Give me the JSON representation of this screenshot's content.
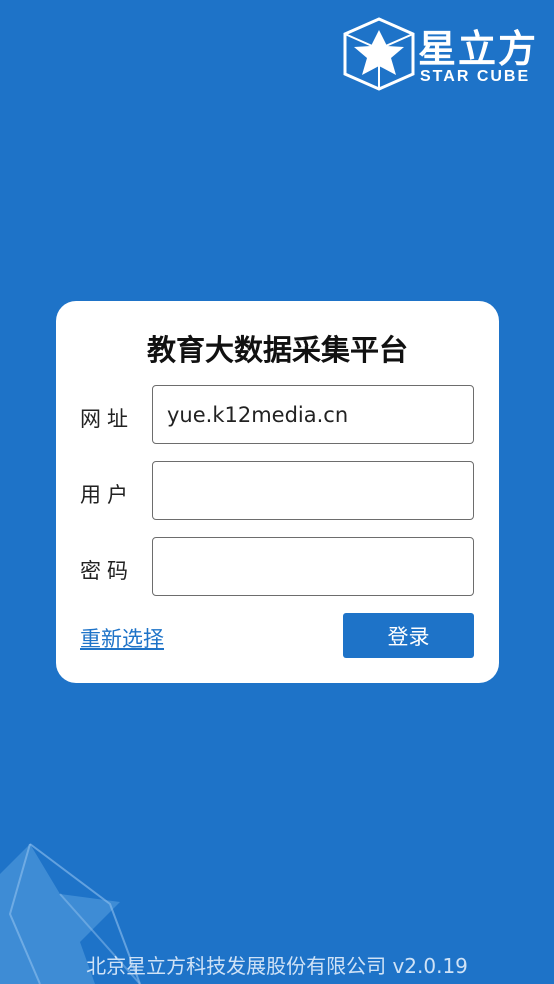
{
  "brand": {
    "name_cn": "星立方",
    "name_en": "STAR CUBE"
  },
  "login": {
    "title": "教育大数据采集平台",
    "fields": [
      {
        "label": "网址",
        "value": "yue.k12media.cn",
        "placeholder": ""
      },
      {
        "label": "用户",
        "value": "",
        "placeholder": ""
      },
      {
        "label": "密码",
        "value": "",
        "placeholder": ""
      }
    ],
    "reselect_label": "重新选择",
    "submit_label": "登录"
  },
  "footer": {
    "company": "北京星立方科技发展股份有限公司",
    "version": "v2.0.19"
  },
  "icons": {
    "logo": "star-cube-logo-icon",
    "background": "star-cube-background-icon"
  },
  "colors": {
    "background": "#1e73c8",
    "accent": "#1e73c8",
    "card": "#ffffff",
    "footer_text": "#cfe2f6"
  }
}
